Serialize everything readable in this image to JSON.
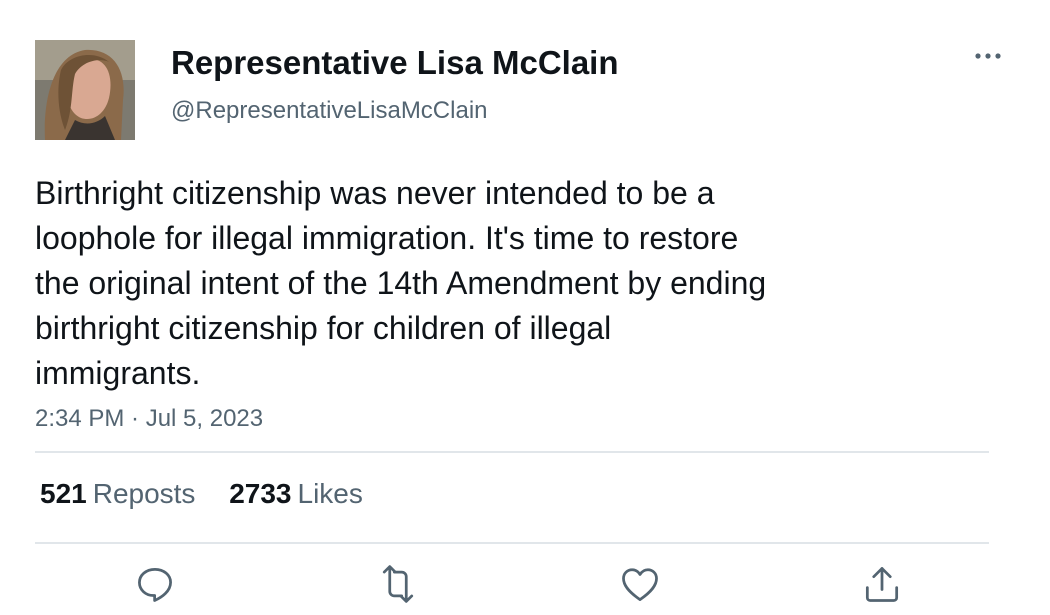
{
  "author": {
    "display_name": "Representative Lisa McClain",
    "handle": "@RepresentativeLisaMcClain"
  },
  "tweet": {
    "lines": [
      "Birthright citizenship was never intended to be a",
      "loophole for illegal immigration. It's time to restore",
      "the original intent of the 14th Amendment by ending",
      "birthright citizenship for children of illegal",
      "immigrants."
    ],
    "timestamp": "2:34 PM · Jul 5, 2023"
  },
  "stats": {
    "reposts_count": "521",
    "reposts_label": "Reposts",
    "likes_count": "2733",
    "likes_label": "Likes"
  },
  "icons": {
    "more": "more-icon",
    "reply": "reply-icon",
    "repost": "repost-icon",
    "like": "like-icon",
    "share": "share-icon"
  },
  "colors": {
    "text_primary": "#0f1419",
    "text_secondary": "#536471",
    "divider": "#e1e6ea"
  }
}
